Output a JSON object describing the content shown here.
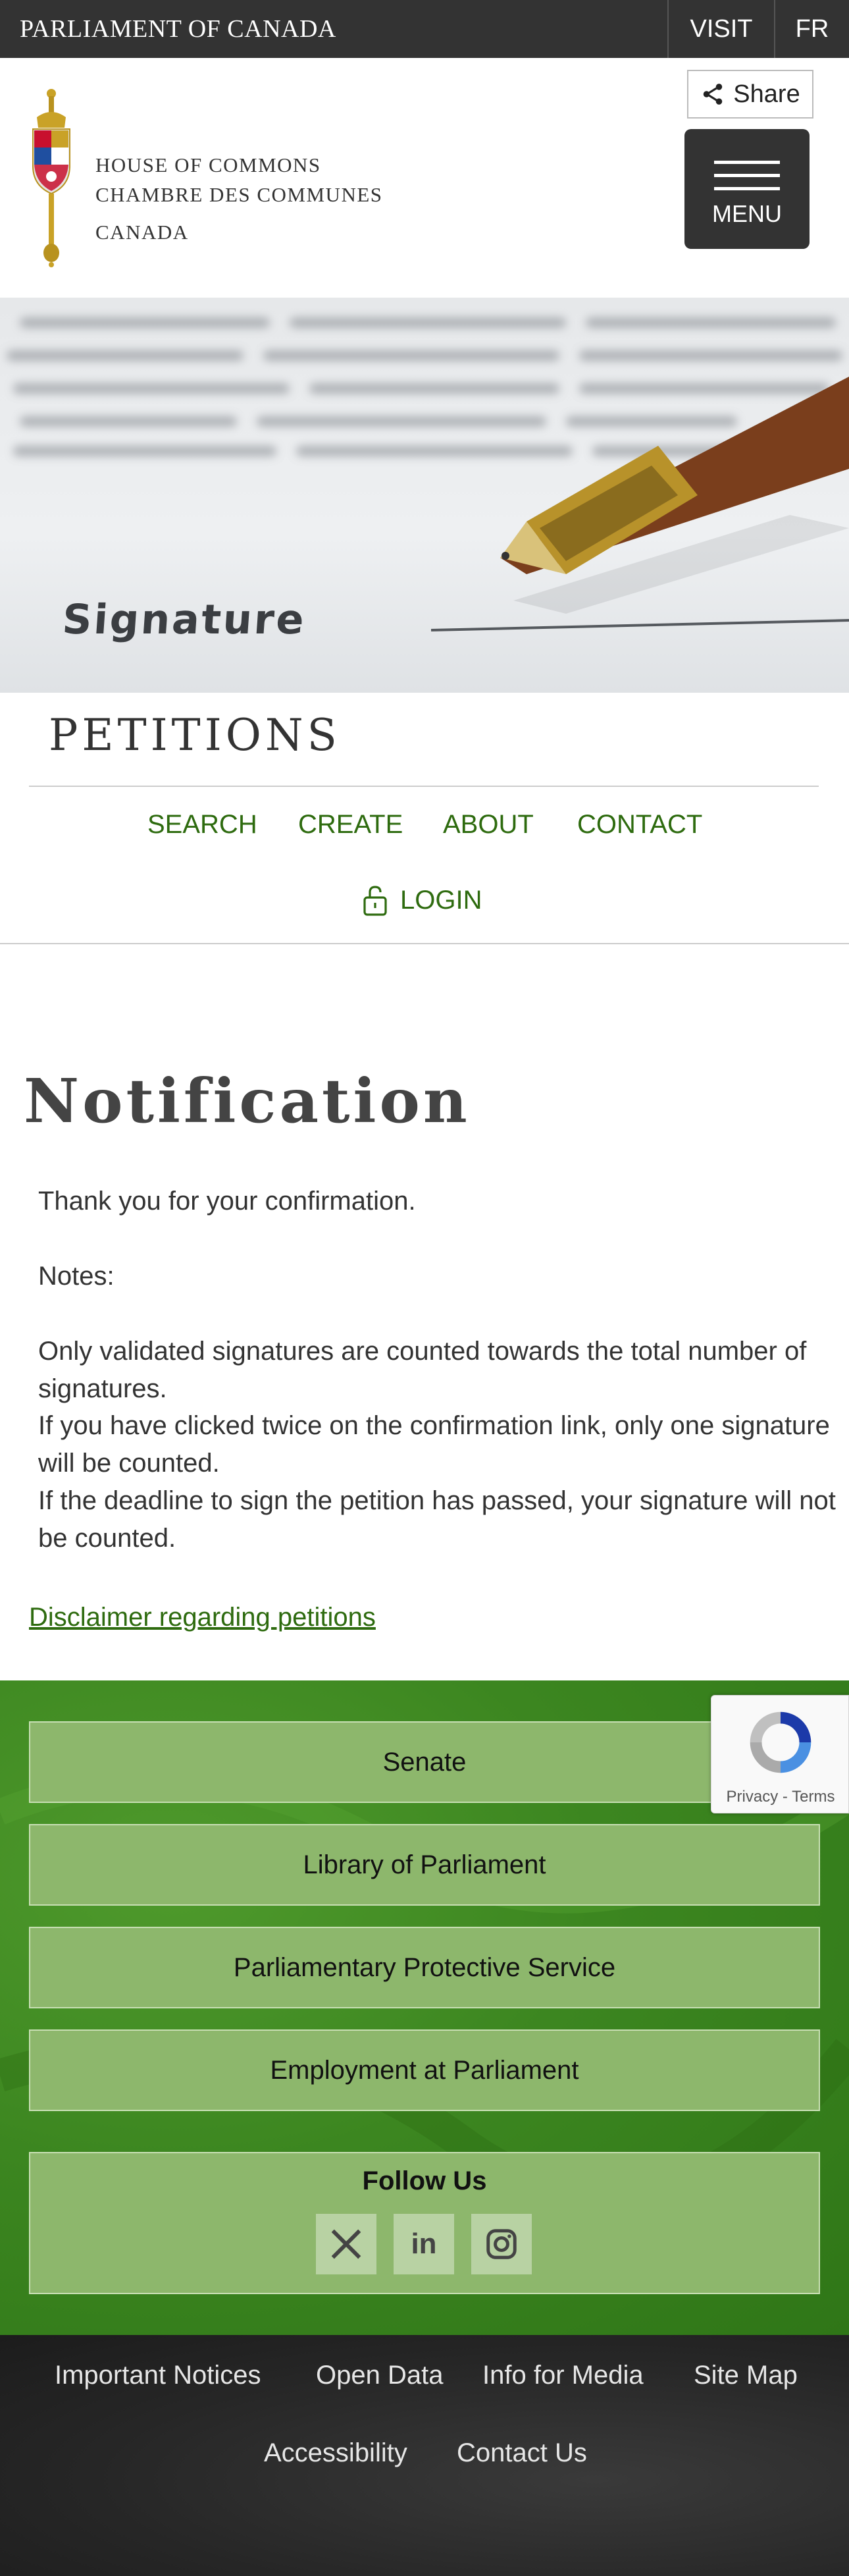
{
  "topbar": {
    "brand": "PARLIAMENT OF CANADA",
    "visit": "VISIT",
    "fr": "FR"
  },
  "header": {
    "line1": "HOUSE OF COMMONS",
    "line2": "CHAMBRE DES COMMUNES",
    "line3": "CANADA",
    "share_label": "Share",
    "menu_label": "MENU",
    "icons": {
      "share": "share-icon",
      "menu": "hamburger-icon",
      "crest": "coat-of-arms-icon"
    }
  },
  "hero": {
    "signature_text": "Signature"
  },
  "petitions": {
    "title": "PETITIONS",
    "nav": [
      "SEARCH",
      "CREATE",
      "ABOUT",
      "CONTACT"
    ],
    "login": "LOGIN",
    "login_icon": "unlock-icon"
  },
  "notification": {
    "heading": "Notification",
    "thanks": "Thank you for your confirmation.",
    "notes_label": "Notes:",
    "notes": [
      "Only validated signatures are counted towards the total number of signatures.",
      "If you have clicked twice on the confirmation link, only one signature will be counted.",
      "If the deadline to sign the petition has passed, your signature will not be counted."
    ],
    "disclaimer_link": "Disclaimer regarding petitions"
  },
  "footer_green": {
    "buttons": [
      "Senate",
      "Library of Parliament",
      "Parliamentary Protective Service",
      "Employment at Parliament"
    ],
    "follow_us": "Follow Us",
    "social_icons": [
      "x-icon",
      "linkedin-icon",
      "instagram-icon"
    ]
  },
  "recaptcha": {
    "links": "Privacy - Terms"
  },
  "footer_dark": {
    "links_row1": [
      "Important Notices",
      "Open Data",
      "Info for Media",
      "Site Map"
    ],
    "links_row2": [
      "Accessibility",
      "Contact Us"
    ]
  },
  "colors": {
    "link_green": "#2e6b0f",
    "topbar": "#333333",
    "footer_green": "#3c8620",
    "button_green": "#8db76c"
  }
}
